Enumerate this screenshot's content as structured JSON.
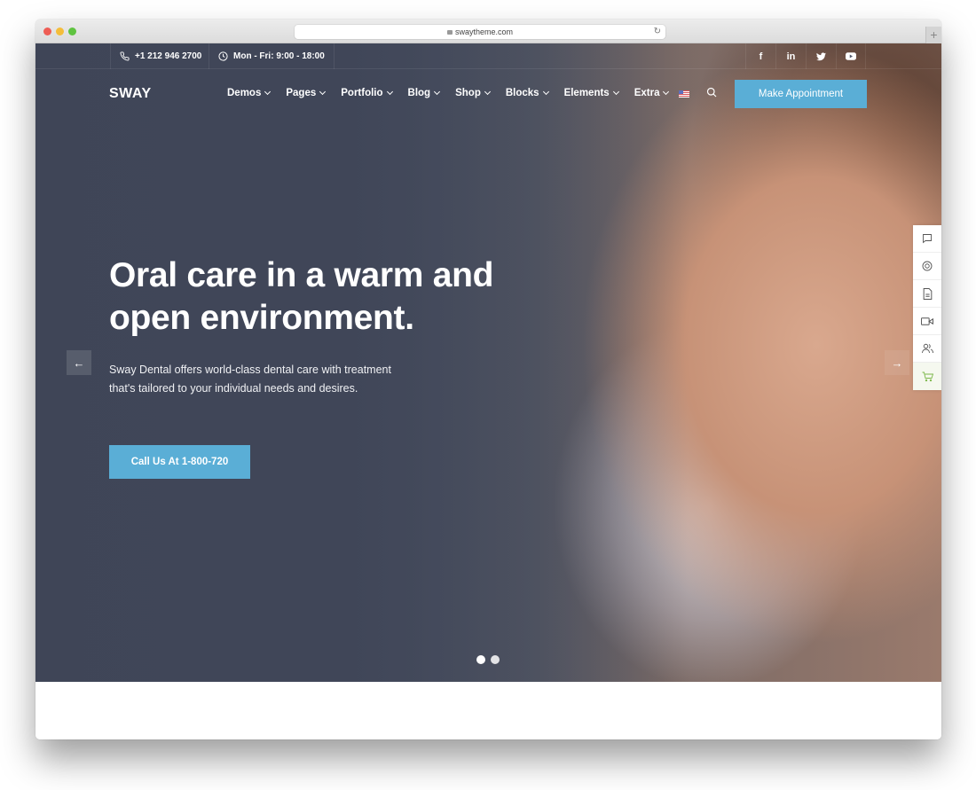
{
  "browser": {
    "url": "swaytheme.com"
  },
  "topbar": {
    "phone": "+1 212 946 2700",
    "hours": "Mon - Fri: 9:00 - 18:00",
    "socials": [
      {
        "icon": "facebook-icon",
        "glyph": "f"
      },
      {
        "icon": "linkedin-icon",
        "glyph": "in"
      },
      {
        "icon": "twitter-icon",
        "glyph": "🐦"
      },
      {
        "icon": "youtube-icon",
        "glyph": "▶"
      }
    ]
  },
  "navbar": {
    "logo": "SWAY",
    "items": [
      {
        "label": "Demos"
      },
      {
        "label": "Pages"
      },
      {
        "label": "Portfolio"
      },
      {
        "label": "Blog"
      },
      {
        "label": "Shop"
      },
      {
        "label": "Blocks"
      },
      {
        "label": "Elements"
      },
      {
        "label": "Extra"
      }
    ],
    "language": "English (US)",
    "cta_label": "Make Appointment"
  },
  "hero": {
    "headline": "Oral care in a warm and open environment.",
    "lead": "Sway Dental offers world-class dental care with treatment that's tailored to your individual needs and desires.",
    "cta_label": "Call Us At 1-800-720",
    "slide_count": 2,
    "active_slide": 1,
    "prev_glyph": "←",
    "next_glyph": "→"
  },
  "side_tools": [
    {
      "icon": "chat-icon"
    },
    {
      "icon": "support-icon"
    },
    {
      "icon": "document-icon"
    },
    {
      "icon": "video-icon"
    },
    {
      "icon": "users-icon"
    },
    {
      "icon": "cart-icon"
    }
  ],
  "colors": {
    "accent": "#5aaed6",
    "cart_accent": "#7ab648"
  }
}
